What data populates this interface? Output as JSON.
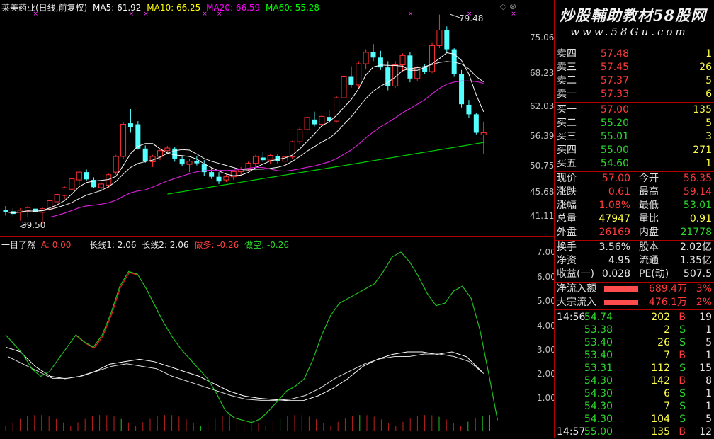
{
  "header": {
    "title": "莱美药业(日线,前复权)",
    "ma5_label": "MA5: 61.92",
    "ma10_label": "MA10: 66.25",
    "ma20_label": "MA20: 66.59",
    "ma60_label": "MA60: 55.28",
    "colors": {
      "ma5": "#ffffff",
      "ma10": "#ffff00",
      "ma20": "#ff00ff",
      "ma60": "#00ff00"
    }
  },
  "price_axis": {
    "ticks": [
      "75.06",
      "68.23",
      "62.03",
      "56.39",
      "50.75",
      "45.68",
      "41.11"
    ]
  },
  "annotations": {
    "high": "79.48",
    "low": "39.50"
  },
  "indicator_header": {
    "name": "一目了然",
    "a_label": "A: 0.00",
    "long1": "长线1: 2.06",
    "long2": "长线2: 2.06",
    "bull": "做多: -0.26",
    "bear": "做空: -0.26"
  },
  "indicator_axis": {
    "ticks": [
      "7.00",
      "6.00",
      "5.00",
      "4.00",
      "3.00",
      "2.00",
      "1.00"
    ]
  },
  "watermark": {
    "line1": "炒股輔助教材58股网",
    "line2": "www.58Gu.com"
  },
  "order_book": {
    "asks": [
      {
        "label": "卖四",
        "price": "57.48",
        "vol": "1"
      },
      {
        "label": "卖三",
        "price": "57.45",
        "vol": "26"
      },
      {
        "label": "卖二",
        "price": "57.37",
        "vol": "5"
      },
      {
        "label": "卖一",
        "price": "57.33",
        "vol": "6"
      }
    ],
    "bids": [
      {
        "label": "买一",
        "price": "57.00",
        "vol": "135"
      },
      {
        "label": "买二",
        "price": "55.20",
        "vol": "5"
      },
      {
        "label": "买三",
        "price": "55.01",
        "vol": "3"
      },
      {
        "label": "买四",
        "price": "55.00",
        "vol": "271"
      },
      {
        "label": "买五",
        "price": "54.60",
        "vol": "1"
      }
    ]
  },
  "quote": {
    "rows": [
      {
        "l1": "现价",
        "v1": "57.00",
        "l2": "今开",
        "v2": "56.35"
      },
      {
        "l1": "涨跌",
        "v1": "0.61",
        "l2": "最高",
        "v2": "59.14"
      },
      {
        "l1": "涨幅",
        "v1": "1.08%",
        "l2": "最低",
        "v2": "53.01"
      },
      {
        "l1": "总量",
        "v1": "47947",
        "l2": "量比",
        "v2": "0.91"
      },
      {
        "l1": "外盘",
        "v1": "26169",
        "l2": "内盘",
        "v2": "21778"
      }
    ]
  },
  "fundamentals": {
    "rows": [
      {
        "l1": "换手",
        "v1": "3.56%",
        "l2": "股本",
        "v2": "2.02亿"
      },
      {
        "l1": "净资",
        "v1": "4.95",
        "l2": "流通",
        "v2": "1.35亿"
      },
      {
        "l1": "收益(一)",
        "v1": "0.028",
        "l2": "PE(动)",
        "v2": "507.5"
      }
    ]
  },
  "flow": {
    "rows": [
      {
        "label": "净流入额",
        "value": "689.4万",
        "pct": "3%",
        "fill": 0.6
      },
      {
        "label": "大宗流入",
        "value": "476.1万",
        "pct": "2%",
        "fill": 0.6
      }
    ]
  },
  "ticks_list": [
    {
      "time": "14:56",
      "price": "54.74",
      "vol": "202",
      "side": "B",
      "n": "19"
    },
    {
      "time": "",
      "price": "53.38",
      "vol": "2",
      "side": "S",
      "n": "1"
    },
    {
      "time": "",
      "price": "53.40",
      "vol": "26",
      "side": "S",
      "n": "5"
    },
    {
      "time": "",
      "price": "53.40",
      "vol": "7",
      "side": "B",
      "n": "1"
    },
    {
      "time": "",
      "price": "53.31",
      "vol": "112",
      "side": "S",
      "n": "15"
    },
    {
      "time": "",
      "price": "54.30",
      "vol": "142",
      "side": "B",
      "n": "8"
    },
    {
      "time": "",
      "price": "54.30",
      "vol": "6",
      "side": "S",
      "n": "1"
    },
    {
      "time": "",
      "price": "54.30",
      "vol": "7",
      "side": "S",
      "n": "1"
    },
    {
      "time": "",
      "price": "54.30",
      "vol": "104",
      "side": "S",
      "n": "5"
    },
    {
      "time": "14:57",
      "price": "55.00",
      "vol": "135",
      "side": "B",
      "n": "12"
    }
  ]
}
